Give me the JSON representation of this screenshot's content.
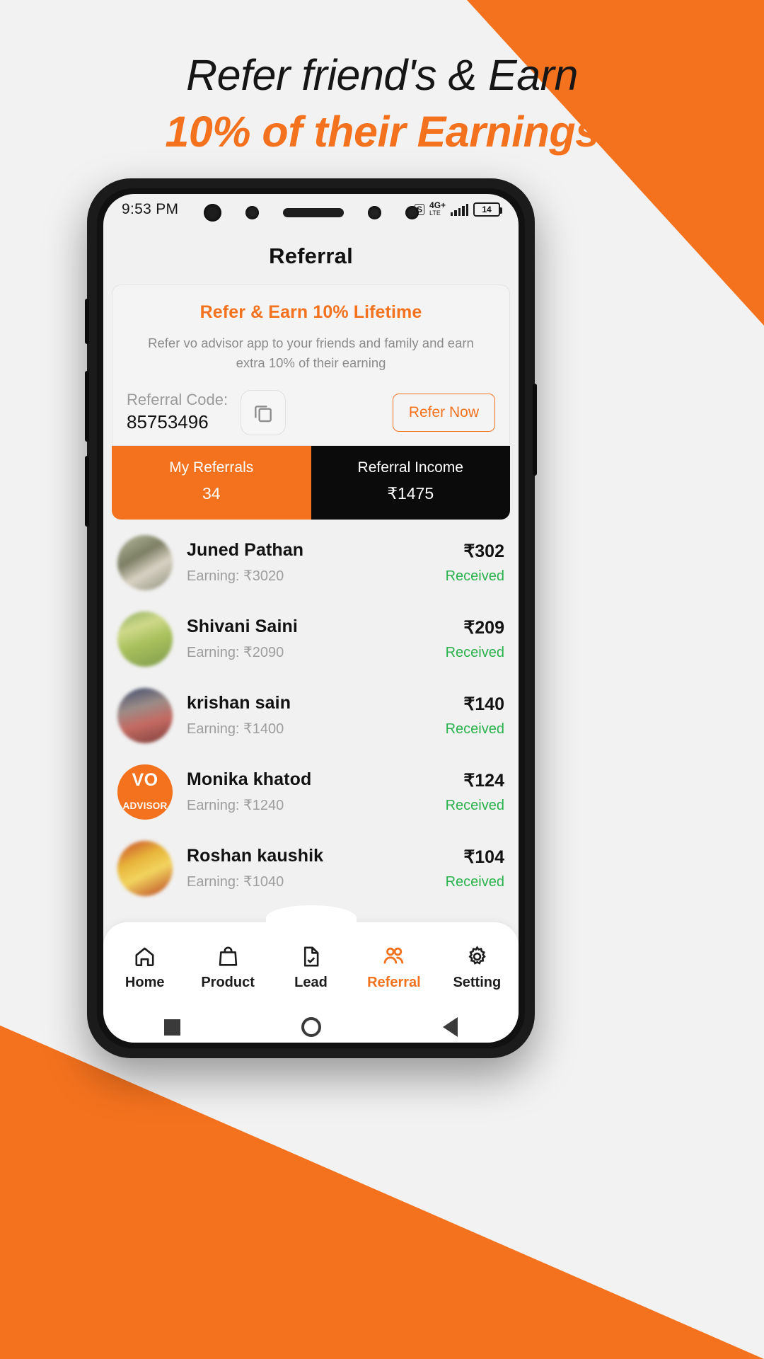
{
  "promo": {
    "line1": "Refer friend's & Earn",
    "line2": "10% of their Earnings",
    "accent_color": "#f4721e"
  },
  "status_bar": {
    "time": "9:53 PM",
    "network_type": "4G+",
    "network_sub": "LTE",
    "sim_icon": "sim-card-icon",
    "signal_icon": "signal-bars-icon",
    "battery_level": "14"
  },
  "header": {
    "title": "Referral"
  },
  "refer_card": {
    "heading": "Refer & Earn 10% Lifetime",
    "description": "Refer vo advisor app to your friends and family and earn extra 10% of their earning",
    "code_label": "Referral Code:",
    "code_value": "85753496",
    "copy_icon": "copy-icon",
    "refer_button": "Refer Now"
  },
  "stats": [
    {
      "title": "My Referrals",
      "value": "34",
      "style": "left"
    },
    {
      "title": "Referral Income",
      "value": "₹1475",
      "style": "right"
    }
  ],
  "referrals": [
    {
      "name": "Juned Pathan",
      "earning": "Earning: ₹3020",
      "amount": "₹302",
      "status": "Received",
      "avatar": "av-1",
      "blur": true
    },
    {
      "name": "Shivani Saini",
      "earning": "Earning: ₹2090",
      "amount": "₹209",
      "status": "Received",
      "avatar": "av-2",
      "blur": true
    },
    {
      "name": "krishan sain",
      "earning": "Earning: ₹1400",
      "amount": "₹140",
      "status": "Received",
      "avatar": "av-3",
      "blur": true
    },
    {
      "name": "Monika khatod",
      "earning": "Earning: ₹1240",
      "amount": "₹124",
      "status": "Received",
      "avatar": "av-4",
      "blur": false,
      "logo_top": "VO",
      "logo_bottom": "ADVISOR"
    },
    {
      "name": "Roshan kaushik",
      "earning": "Earning: ₹1040",
      "amount": "₹104",
      "status": "Received",
      "avatar": "av-5",
      "blur": true
    }
  ],
  "bottom_nav": [
    {
      "label": "Home",
      "icon": "home-icon",
      "active": false
    },
    {
      "label": "Product",
      "icon": "bag-icon",
      "active": false
    },
    {
      "label": "Lead",
      "icon": "document-check-icon",
      "active": false
    },
    {
      "label": "Referral",
      "icon": "people-icon",
      "active": true
    },
    {
      "label": "Setting",
      "icon": "gear-icon",
      "active": false
    }
  ],
  "system_nav": [
    {
      "icon": "recents-square-icon"
    },
    {
      "icon": "home-circle-icon"
    },
    {
      "icon": "back-triangle-icon"
    }
  ],
  "status_color": "#2bb24c"
}
